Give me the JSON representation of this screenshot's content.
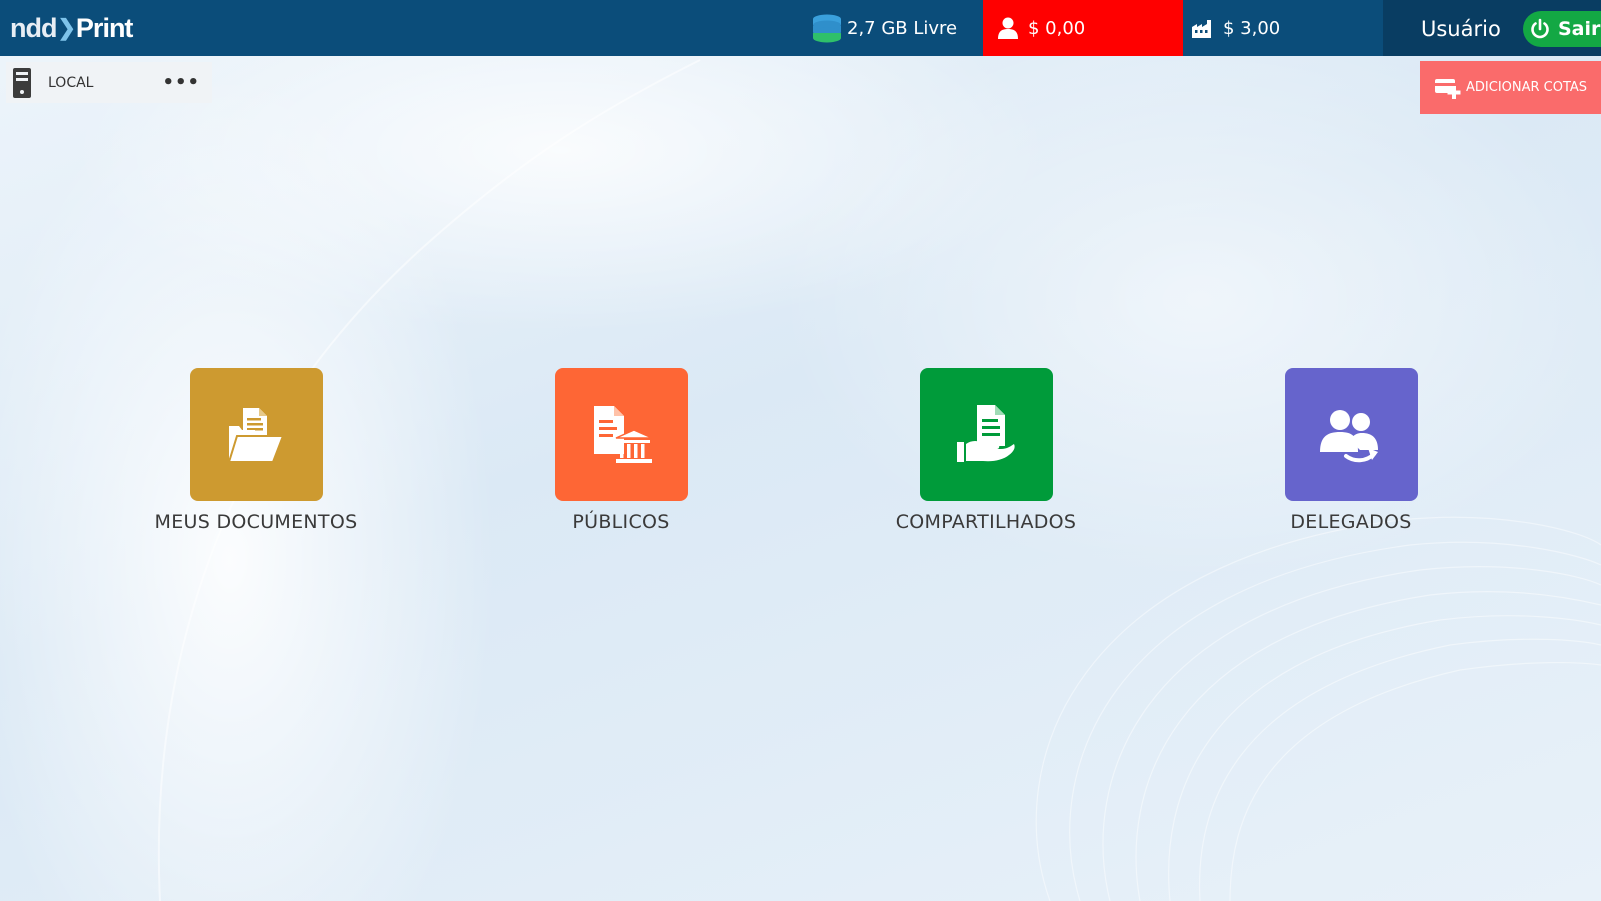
{
  "header": {
    "logo_prefix": "ndd",
    "logo_suffix": "Print",
    "storage_text": "2,7 GB Livre",
    "user_quota": "$ 0,00",
    "company_quota": "$ 3,00",
    "username": "Usuário",
    "logout_label": "Sair"
  },
  "location": {
    "label": "LOCAL",
    "more": "•••"
  },
  "add_quota_label": "ADICIONAR COTAS",
  "tiles": [
    {
      "label": "MEUS DOCUMENTOS",
      "color": "#cd9a30",
      "icon": "folder-document-icon"
    },
    {
      "label": "PÚBLICOS",
      "color": "#fe6635",
      "icon": "public-document-icon"
    },
    {
      "label": "COMPARTILHADOS",
      "color": "#009b3a",
      "icon": "shared-document-icon"
    },
    {
      "label": "DELEGADOS",
      "color": "#6664cc",
      "icon": "delegated-users-icon"
    }
  ],
  "colors": {
    "header": "#0b4d7a",
    "user_quota_bg": "#ff0000",
    "logout_bg": "#13a844",
    "add_quota_bg": "#fa6b6b"
  }
}
